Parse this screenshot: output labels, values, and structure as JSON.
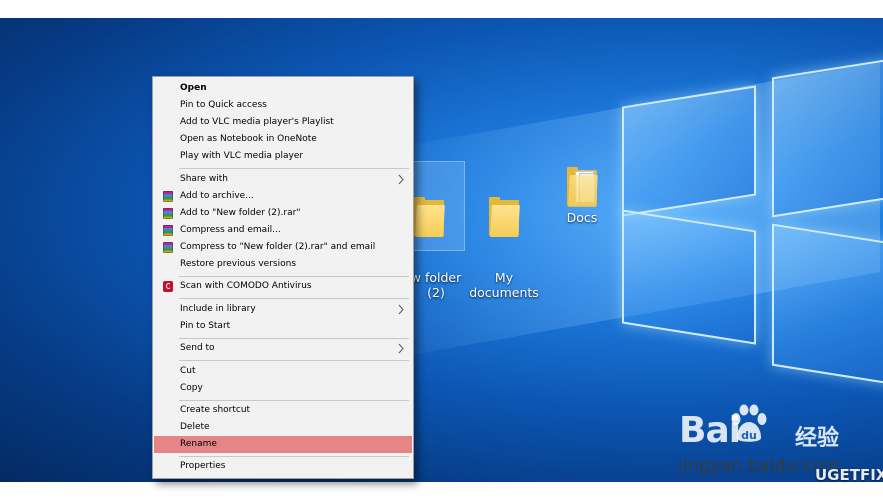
{
  "desktop": {
    "icons": [
      {
        "label": "New folder\n(2)",
        "visible_label": "w folder\n(2)"
      },
      {
        "label": "My\ndocuments"
      },
      {
        "label": "Docs"
      }
    ]
  },
  "context_menu": {
    "items": [
      {
        "label": "Open",
        "icon": null,
        "submenu": false,
        "bold": true
      },
      {
        "label": "Pin to Quick access",
        "icon": null,
        "submenu": false
      },
      {
        "label": "Add to VLC media player's Playlist",
        "icon": null,
        "submenu": false
      },
      {
        "label": "Open as Notebook in OneNote",
        "icon": null,
        "submenu": false
      },
      {
        "label": "Play with VLC media player",
        "icon": null,
        "submenu": false
      },
      {
        "label": "Share with",
        "icon": null,
        "submenu": true
      },
      {
        "label": "Add to archive...",
        "icon": "winrar-icon",
        "submenu": false
      },
      {
        "label": "Add to \"New folder (2).rar\"",
        "icon": "winrar-icon",
        "submenu": false
      },
      {
        "label": "Compress and email...",
        "icon": "winrar-icon",
        "submenu": false
      },
      {
        "label": "Compress to \"New folder (2).rar\" and email",
        "icon": "winrar-icon",
        "submenu": false
      },
      {
        "label": "Restore previous versions",
        "icon": null,
        "submenu": false
      },
      {
        "label": "Scan with COMODO Antivirus",
        "icon": "comodo-icon",
        "submenu": false
      },
      {
        "label": "Include in library",
        "icon": null,
        "submenu": true
      },
      {
        "label": "Pin to Start",
        "icon": null,
        "submenu": false
      },
      {
        "label": "Send to",
        "icon": null,
        "submenu": true
      },
      {
        "label": "Cut",
        "icon": null,
        "submenu": false
      },
      {
        "label": "Copy",
        "icon": null,
        "submenu": false
      },
      {
        "label": "Create shortcut",
        "icon": null,
        "submenu": false
      },
      {
        "label": "Delete",
        "icon": null,
        "submenu": false
      },
      {
        "label": "Rename",
        "icon": null,
        "submenu": false,
        "highlighted": true
      },
      {
        "label": "Properties",
        "icon": null,
        "submenu": false
      }
    ],
    "highlight_color": "#e58585"
  },
  "watermarks": {
    "baidu_logo_text": "Bai",
    "baidu_logo_suffix": "经验",
    "baidu_url": "jingyan.baidu.com",
    "ugetfix": "UGETFIX"
  },
  "colors": {
    "desktop_blue": "#0c56b3",
    "menu_background": "#f2f2f2"
  }
}
